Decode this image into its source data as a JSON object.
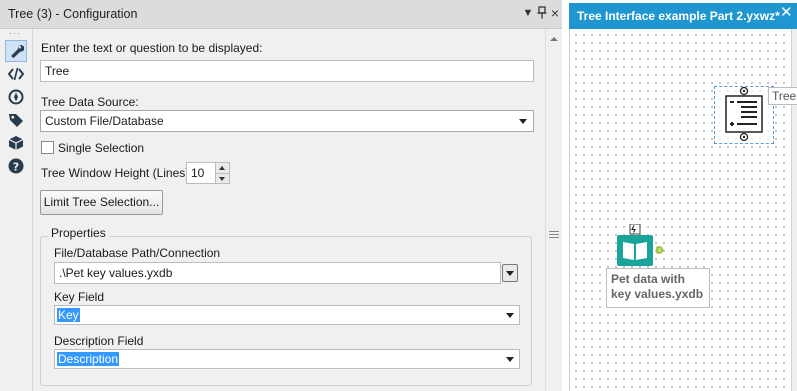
{
  "panel": {
    "title": "Tree (3) - Configuration",
    "header_controls": [
      "▼",
      "pin",
      "×"
    ]
  },
  "toolbar": {
    "items": [
      {
        "name": "configuration",
        "icon": "wrench-icon",
        "active": true
      },
      {
        "name": "annotation",
        "icon": "code-tags-icon",
        "active": false
      },
      {
        "name": "settings",
        "icon": "compass-icon",
        "active": false
      },
      {
        "name": "tags",
        "icon": "tag-icon",
        "active": false
      },
      {
        "name": "metadata",
        "icon": "cube-icon",
        "active": false
      },
      {
        "name": "help",
        "icon": "help-icon",
        "active": false
      }
    ]
  },
  "form": {
    "prompt_label": "Enter the text or question to be displayed:",
    "prompt_value": "Tree",
    "source_label": "Tree Data Source:",
    "source_value": "Custom File/Database",
    "single_selection_label": "Single Selection",
    "single_selection_checked": false,
    "height_label": "Tree Window Height (Lines):",
    "height_value": "10",
    "limit_button_label": "Limit Tree Selection...",
    "properties": {
      "legend": "Properties",
      "path_label": "File/Database Path/Connection",
      "path_value": ".\\Pet key values.yxdb",
      "key_label": "Key Field",
      "key_value": "Key",
      "desc_label": "Description Field",
      "desc_value": "Description"
    }
  },
  "canvas": {
    "tab_title": "Tree Interface example Part 2.yxwz*",
    "tree_tool_label": "Tree",
    "input_tool_caption": "Pet data with key values.yxdb"
  },
  "colors": {
    "tab_blue": "#1f96cf",
    "selection_blue": "#3399ff",
    "input_tool_teal": "#1aa39a",
    "output_anchor_green": "#b6e84a"
  }
}
